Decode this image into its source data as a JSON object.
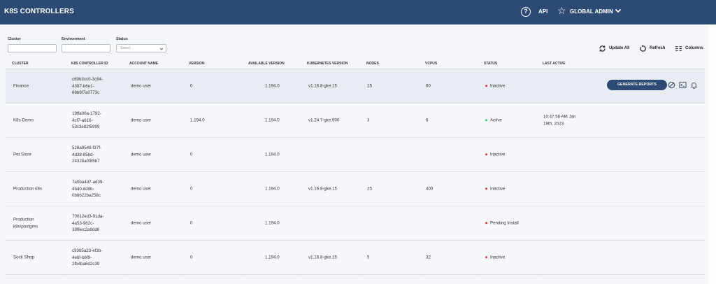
{
  "header": {
    "title": "K8S CONTROLLERS",
    "help_glyph": "?",
    "api_label": "API",
    "admin_label": "GLOBAL ADMIN"
  },
  "filters": {
    "cluster_label": "Cluster",
    "environment_label": "Environment",
    "status_label": "Status",
    "status_placeholder": "Select..."
  },
  "toolbar": {
    "update_all": "Update All",
    "refresh": "Refresh",
    "columns": "Columns"
  },
  "table": {
    "headers": [
      "CLUSTER",
      "K8S CONTROLLER ID",
      "ACCOUNT NAME",
      "VERSION",
      "AVAILABLE VERSION",
      "KUBERNETES VERSION",
      "NODES",
      "VCPUS",
      "STATUS",
      "LAST ACTIVE"
    ],
    "generate_reports_label": "GENERATE REPORTS",
    "rows": [
      {
        "cluster": "Finance",
        "id": [
          "c69b3cc0-3c84-",
          "4397-b6e1-",
          "66b6f7a0773c"
        ],
        "account": "demo user",
        "version": "0",
        "available": "1.194.0",
        "k8s": "v1.16.8-gke.15",
        "nodes": "15",
        "vcpus": "60",
        "status": "Inactive",
        "status_color": "#e53935",
        "last_active": [
          "",
          ""
        ]
      },
      {
        "cluster": "K8s Demo",
        "id": [
          "19ffa00a-1792-",
          "4cf7-a616-",
          "53c3e82f5999"
        ],
        "account": "demo user",
        "version": "1.194.0",
        "available": "1.194.0",
        "k8s": "v1.24.7-gke.900",
        "nodes": "3",
        "vcpus": "6",
        "status": "Active",
        "status_color": "#2ecc71",
        "last_active": [
          "10:47:56 AM Jan",
          "19th, 2023"
        ]
      },
      {
        "cluster": "Pet Store",
        "id": [
          "528a9548-f37f-",
          "4d38-85bd-",
          "24328a0f85b7"
        ],
        "account": "demo user",
        "version": "0",
        "available": "1.194.0",
        "k8s": "",
        "nodes": "",
        "vcpus": "",
        "status": "Inactive",
        "status_color": "#e53935",
        "last_active": [
          "",
          ""
        ]
      },
      {
        "cluster": "Production k8s",
        "id": [
          "7e0ba4d7-ad39-",
          "4b40-8d9b-",
          "0b8622ba258c"
        ],
        "account": "demo user",
        "version": "0",
        "available": "1.194.0",
        "k8s": "v1.16.8-gke.15",
        "nodes": "25",
        "vcpus": "400",
        "status": "Inactive",
        "status_color": "#e53935",
        "last_active": [
          "",
          ""
        ]
      },
      {
        "cluster": [
          "Production",
          "k8s\\postgres"
        ],
        "id": [
          "70012ed3-91da-",
          "4a53-962c-",
          "39f6ec2a9dd6"
        ],
        "account": "demo user",
        "version": "0",
        "available": "1.194.0",
        "k8s": "",
        "nodes": "",
        "vcpus": "",
        "status": "Pending Install",
        "status_color": "#e53935",
        "last_active": [
          "",
          ""
        ]
      },
      {
        "cluster": "Sock Shop",
        "id": [
          "c9365a23-ef3b-",
          "4e6f-b6f9-",
          "2fb4ba6d2c39"
        ],
        "account": "demo user",
        "version": "0",
        "available": "1.194.0",
        "k8s": "v1.16.8-gke.15",
        "nodes": "5",
        "vcpus": "32",
        "status": "Inactive",
        "status_color": "#e53935",
        "last_active": [
          "",
          ""
        ]
      }
    ]
  },
  "icons": {
    "help": "help-icon",
    "star": "star-icon",
    "chevron": "chevron-down-icon",
    "update_all": "sync-icon",
    "refresh": "refresh-icon",
    "columns": "columns-icon",
    "block": "block-icon",
    "terminal": "terminal-icon",
    "bell": "bell-icon"
  },
  "colors": {
    "header_bg": "#2c4a73",
    "primary_button": "#2c4a73",
    "inactive": "#e53935",
    "active": "#2ecc71"
  }
}
